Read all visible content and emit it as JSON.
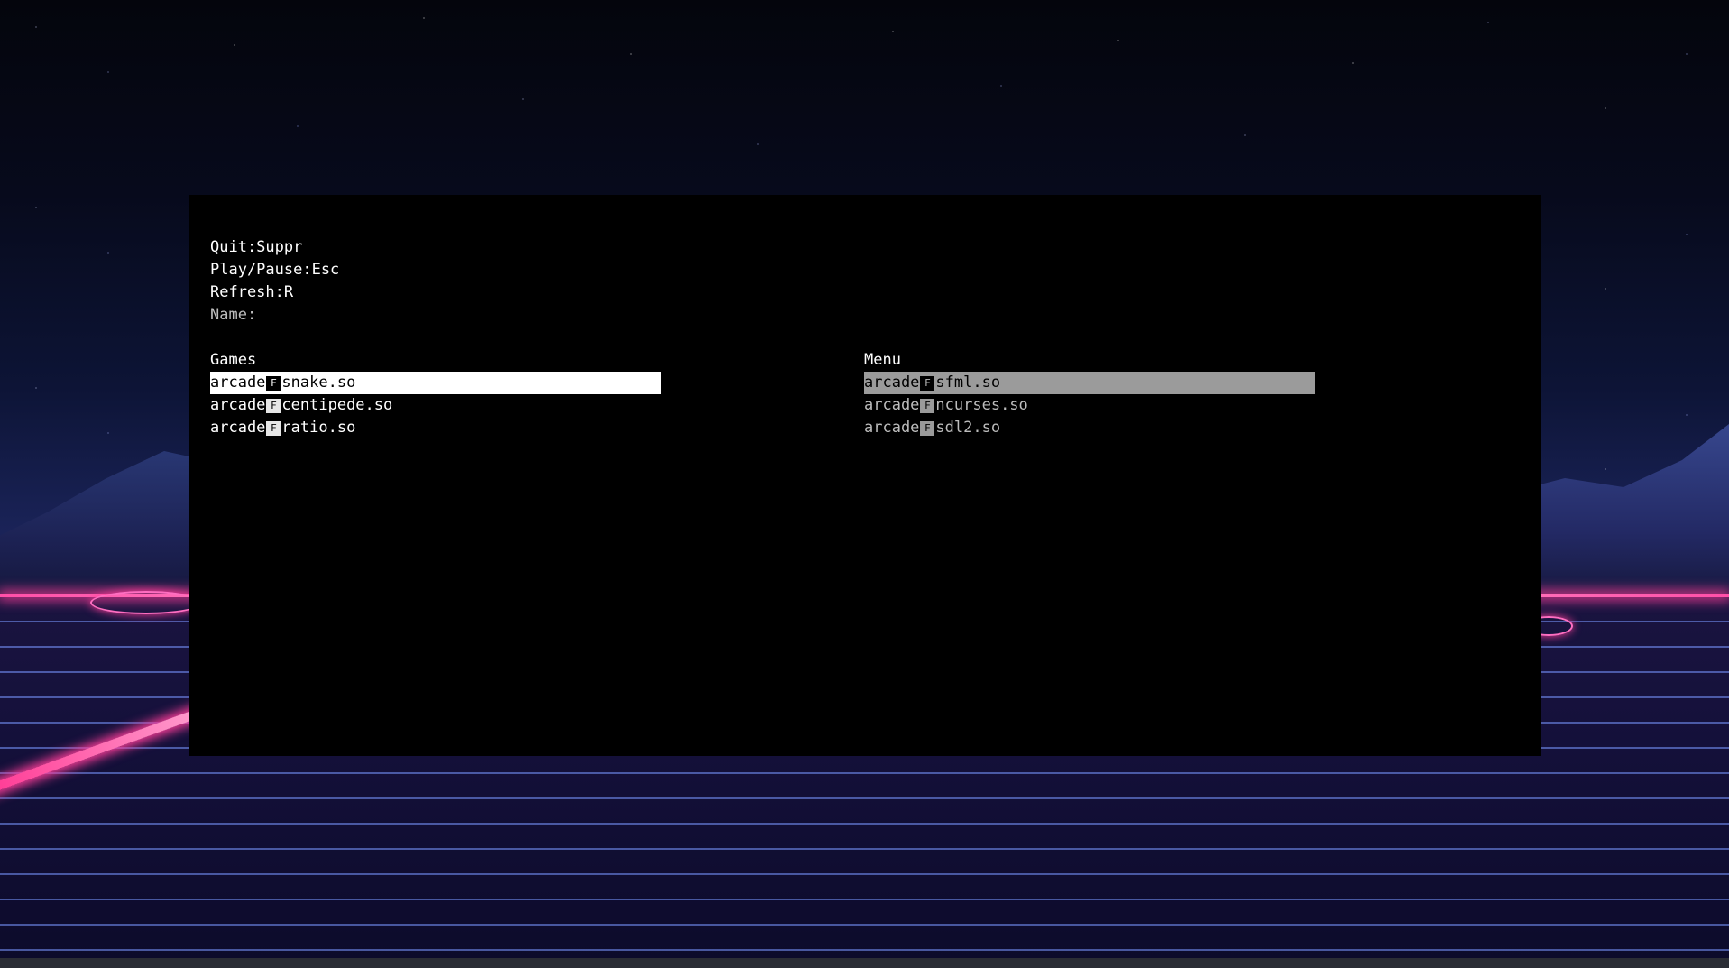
{
  "help": {
    "quit": "Quit:Suppr",
    "play_pause": "Play/Pause:Esc",
    "refresh": "Refresh:R",
    "name": "Name:"
  },
  "games": {
    "heading": "Games",
    "items": [
      {
        "prefix": "arcade",
        "suffix": "snake.so",
        "selected": true
      },
      {
        "prefix": "arcade",
        "suffix": "centipede.so"
      },
      {
        "prefix": "arcade",
        "suffix": "ratio.so"
      }
    ]
  },
  "menu": {
    "heading": "Menu",
    "items": [
      {
        "prefix": "arcade",
        "suffix": "sfml.so",
        "selected": true
      },
      {
        "prefix": "arcade",
        "suffix": "ncurses.so"
      },
      {
        "prefix": "arcade",
        "suffix": "sdl2.so"
      }
    ]
  },
  "separator_glyph": "F",
  "colors": {
    "terminal_bg": "#000000",
    "games_selected_bg": "#ffffff",
    "menu_selected_bg": "#9b9b9b",
    "neon_pink": "#ff3d9a"
  }
}
